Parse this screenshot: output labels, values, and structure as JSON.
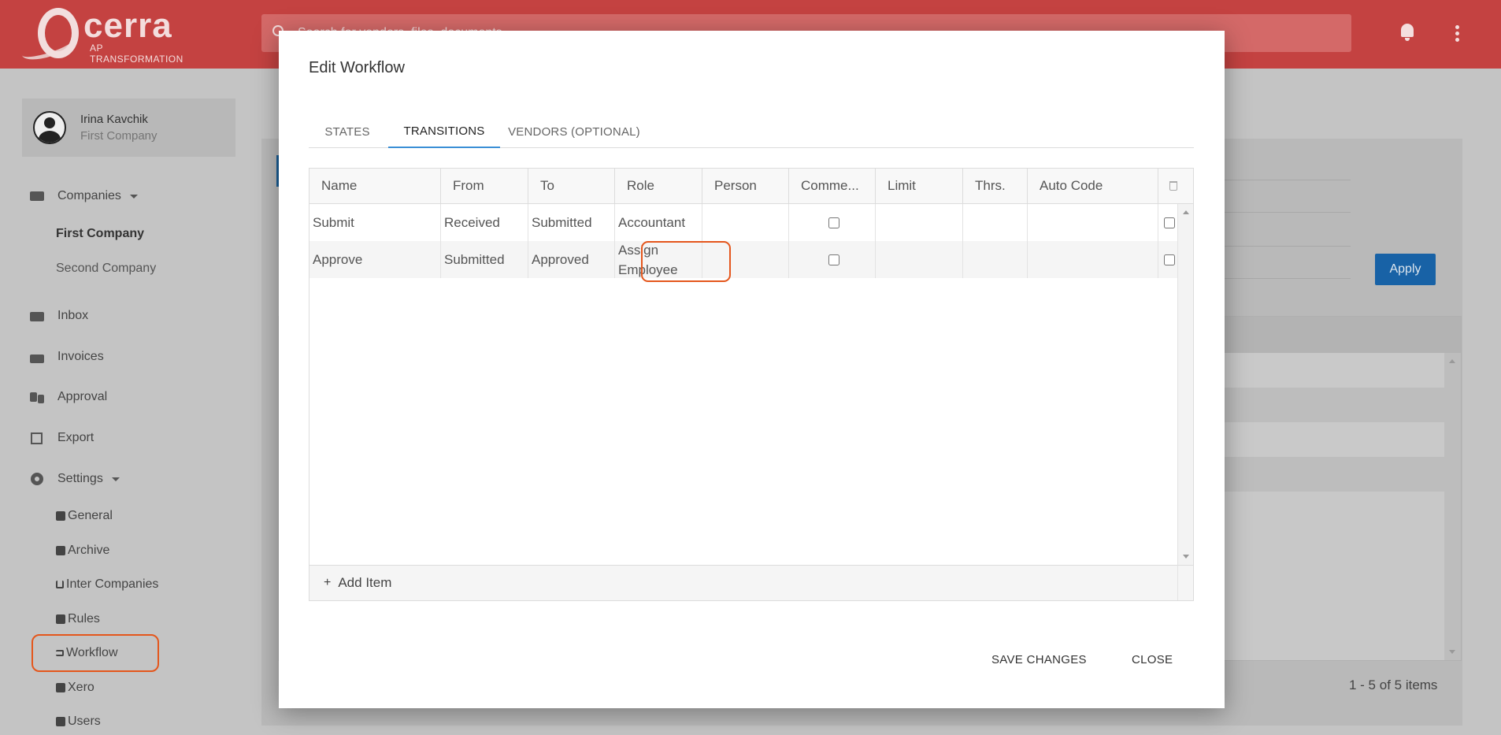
{
  "app": {
    "logo_text": "cerra",
    "logo_subtitle": "AP TRANSFORMATION",
    "search_placeholder": "Search for vendors, files, documents",
    "icons": [
      "search-icon",
      "bell-icon",
      "kebab-menu-icon"
    ]
  },
  "user": {
    "name": "Irina Kavchik",
    "company": "First Company"
  },
  "sidebar": {
    "companies_label": "Companies",
    "companies": [
      "First Company",
      "Second Company"
    ],
    "inbox": "Inbox",
    "invoices": "Invoices",
    "approval": "Approval",
    "export": "Export",
    "settings_label": "Settings",
    "settings_items": [
      "General",
      "Archive",
      "Inter Companies",
      "Rules",
      "Workflow",
      "Xero",
      "Users"
    ]
  },
  "background": {
    "apply_label": "Apply",
    "pager_text": "1 - 5 of 5 items"
  },
  "modal": {
    "title": "Edit Workflow",
    "tabs": [
      "STATES",
      "TRANSITIONS",
      "VENDORS (OPTIONAL)"
    ],
    "active_tab": "TRANSITIONS",
    "columns": [
      "Name",
      "From",
      "To",
      "Role",
      "Person",
      "Comme...",
      "Limit",
      "Thrs.",
      "Auto Code"
    ],
    "rows": [
      {
        "name": "Submit",
        "from": "Received",
        "to": "Submitted",
        "role": "Accountant",
        "person": "",
        "comment": false,
        "limit": "",
        "thrs": "",
        "auto_code": "",
        "selected": false
      },
      {
        "name": "Approve",
        "from": "Submitted",
        "to": "Approved",
        "role": "Assign Employee",
        "person": "",
        "comment": false,
        "limit": "",
        "thrs": "",
        "auto_code": "",
        "selected": false
      }
    ],
    "add_item_label": "Add Item",
    "save_label": "SAVE CHANGES",
    "close_label": "CLOSE"
  },
  "colors": {
    "topbar": "#c44241",
    "accent": "#3a8fd6",
    "highlight": "#e4561c",
    "apply_button": "#1862a6"
  }
}
